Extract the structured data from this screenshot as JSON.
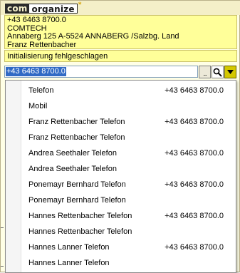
{
  "logo": {
    "part1": "com",
    "part2": "organize",
    "mark": "*"
  },
  "contact": {
    "phone": "+43 6463 8700.0",
    "company": "COMTECH",
    "address": "Annaberg 125 A-5524 ANNABERG /Salzbg. Land",
    "person": "Franz Rettenbacher"
  },
  "status": "Initialisierung fehlgeschlagen",
  "input": {
    "value": "+43 6463 8700.0"
  },
  "buttons": {
    "dots": "...",
    "search_icon": "magnifier-icon",
    "dropdown_icon": "triangle-down-icon"
  },
  "list": [
    {
      "name": "Telefon",
      "number": "+43 6463 8700.0"
    },
    {
      "name": "Mobil",
      "number": ""
    },
    {
      "name": "Franz Rettenbacher Telefon",
      "number": "+43 6463 8700.0"
    },
    {
      "name": "Franz Rettenbacher Telefon",
      "number": ""
    },
    {
      "name": "Andrea Seethaler Telefon",
      "number": "+43 6463 8700.0"
    },
    {
      "name": "Andrea Seethaler Telefon",
      "number": ""
    },
    {
      "name": "Ponemayr Bernhard Telefon",
      "number": "+43 6463 8700.0"
    },
    {
      "name": "Ponemayr Bernhard Telefon",
      "number": ""
    },
    {
      "name": "Hannes Rettenbacher Telefon",
      "number": "+43 6463 8700.0"
    },
    {
      "name": "Hannes Rettenbacher Telefon",
      "number": ""
    },
    {
      "name": "Hannes Lanner Telefon",
      "number": "+43 6463 8700.0"
    },
    {
      "name": "Hannes Lanner Telefon",
      "number": ""
    }
  ],
  "colors": {
    "info_bg": "#ffff99",
    "selection": "#316ac5",
    "accent_button": "#d4c800"
  }
}
